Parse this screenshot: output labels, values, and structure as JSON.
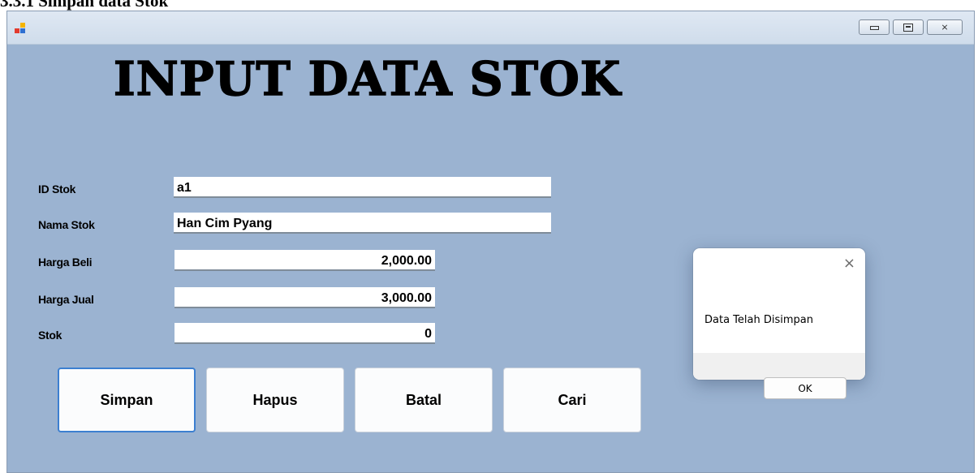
{
  "document": {
    "caption": "3.3.1 Simpan data Stok"
  },
  "window": {
    "icons": {
      "app": "app-icon",
      "minimize": "minimize-icon",
      "maximize": "maximize-icon",
      "close": "close-icon"
    },
    "close_glyph": "⨯"
  },
  "form": {
    "heading": "INPUT DATA STOK",
    "fields": [
      {
        "label": "ID Stok",
        "value": "a1"
      },
      {
        "label": "Nama Stok",
        "value": "Han Cim Pyang"
      },
      {
        "label": "Harga Beli",
        "value": "2,000.00"
      },
      {
        "label": "Harga Jual",
        "value": "3,000.00"
      },
      {
        "label": "Stok",
        "value": "0"
      }
    ],
    "buttons": {
      "simpan": "Simpan",
      "hapus": "Hapus",
      "batal": "Batal",
      "cari": "Cari"
    }
  },
  "dialog": {
    "close_glyph": "×",
    "message": "Data Telah Disimpan",
    "ok_label": "OK"
  },
  "colors": {
    "form_background": "#9bb3d1",
    "primary_button_border": "#3c7fd0"
  }
}
